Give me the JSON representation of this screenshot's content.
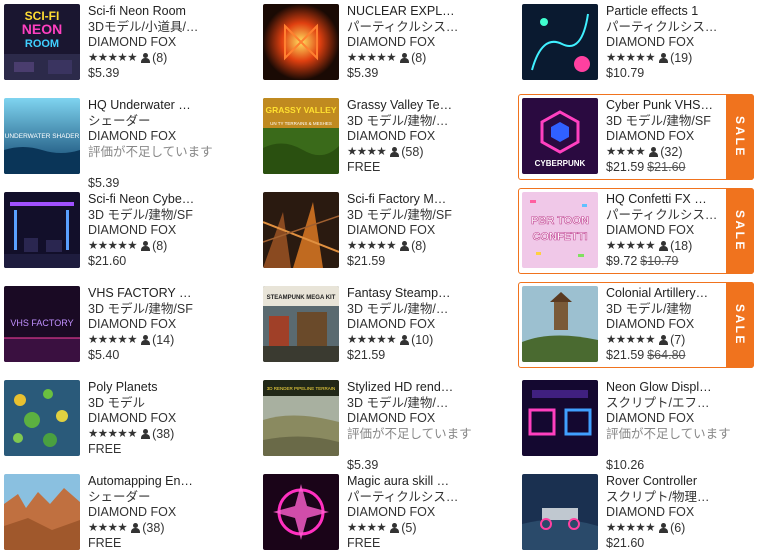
{
  "items": [
    {
      "title": "Sci-fi Neon Room",
      "category": "3Dモデル/小道具/…",
      "publisher": "DIAMOND FOX",
      "stars": "★★★★★",
      "ratings": "(8)",
      "price": "$5.39",
      "thumb": "neon-room"
    },
    {
      "title": "NUCLEAR EXPL…",
      "category": "パーティクルシス…",
      "publisher": "DIAMOND FOX",
      "stars": "★★★★★",
      "ratings": "(8)",
      "price": "$5.39",
      "thumb": "nuclear"
    },
    {
      "title": "Particle effects 1",
      "category": "パーティクルシス…",
      "publisher": "DIAMOND FOX",
      "stars": "★★★★★",
      "ratings": "(19)",
      "price": "$10.79",
      "thumb": "particle"
    },
    {
      "title": "HQ Underwater …",
      "category": "シェーダー",
      "publisher": "DIAMOND FOX",
      "no_rating": "評価が不足しています",
      "price": "$5.39",
      "thumb": "underwater"
    },
    {
      "title": "Grassy Valley Te…",
      "category": "3D モデル/建物/…",
      "publisher": "DIAMOND FOX",
      "stars": "★★★★",
      "ratings": "(58)",
      "price": "FREE",
      "thumb": "grassy"
    },
    {
      "title": "Cyber Punk VHS…",
      "category": "3D モデル/建物/SF",
      "publisher": "DIAMOND FOX",
      "stars": "★★★★",
      "ratings": "(32)",
      "price": "$21.59",
      "old_price": "$21.60",
      "sale": "SALE",
      "thumb": "cyberpunk"
    },
    {
      "title": "Sci-fi Neon Cybe…",
      "category": "3D モデル/建物/SF",
      "publisher": "DIAMOND FOX",
      "stars": "★★★★★",
      "ratings": "(8)",
      "price": "$21.60",
      "thumb": "neon-cyber"
    },
    {
      "title": "Sci-fi Factory M…",
      "category": "3D モデル/建物/SF",
      "publisher": "DIAMOND FOX",
      "stars": "★★★★★",
      "ratings": "(8)",
      "price": "$21.59",
      "thumb": "factory"
    },
    {
      "title": "HQ Confetti FX …",
      "category": "パーティクルシス…",
      "publisher": "DIAMOND FOX",
      "stars": "★★★★★",
      "ratings": "(18)",
      "price": "$9.72",
      "old_price": "$10.79",
      "sale": "SALE",
      "thumb": "confetti"
    },
    {
      "title": "VHS FACTORY …",
      "category": "3D モデル/建物/SF",
      "publisher": "DIAMOND FOX",
      "stars": "★★★★★",
      "ratings": "(14)",
      "price": "$5.40",
      "thumb": "vhs"
    },
    {
      "title": "Fantasy Steamp…",
      "category": "3D モデル/建物/…",
      "publisher": "DIAMOND FOX",
      "stars": "★★★★★",
      "ratings": "(10)",
      "price": "$21.59",
      "thumb": "steampunk"
    },
    {
      "title": "Colonial Artillery…",
      "category": "3D モデル/建物",
      "publisher": "DIAMOND FOX",
      "stars": "★★★★★",
      "ratings": "(7)",
      "price": "$21.59",
      "old_price": "$64.80",
      "sale": "SALE",
      "thumb": "colonial"
    },
    {
      "title": "Poly Planets",
      "category": "3D モデル",
      "publisher": "DIAMOND FOX",
      "stars": "★★★★★",
      "ratings": "(38)",
      "price": "FREE",
      "thumb": "planets"
    },
    {
      "title": "Stylized HD rend…",
      "category": "3D モデル/建物/…",
      "publisher": "DIAMOND FOX",
      "no_rating": "評価が不足しています",
      "price": "$5.39",
      "thumb": "stylized"
    },
    {
      "title": "Neon Glow Displ…",
      "category": "スクリプト/エフ…",
      "publisher": "DIAMOND FOX",
      "no_rating": "評価が不足しています",
      "price": "$10.26",
      "thumb": "neon-glow"
    },
    {
      "title": "Automapping En…",
      "category": "シェーダー",
      "publisher": "DIAMOND FOX",
      "stars": "★★★★",
      "ratings": "(38)",
      "price": "FREE",
      "thumb": "automapping"
    },
    {
      "title": "Magic aura skill …",
      "category": "パーティクルシス…",
      "publisher": "DIAMOND FOX",
      "stars": "★★★★",
      "ratings": "(5)",
      "price": "FREE",
      "thumb": "magic"
    },
    {
      "title": "Rover Controller",
      "category": "スクリプト/物理…",
      "publisher": "DIAMOND FOX",
      "stars": "★★★★★",
      "ratings": "(6)",
      "price": "$21.60",
      "thumb": "rover"
    }
  ],
  "thumb_text": {
    "neon_room": [
      "SCI-FI",
      "NEON",
      "ROOM"
    ],
    "underwater": "UNDERWATER SHADER",
    "grassy": "GRASSY VALLEY",
    "grassy_sub": "UN TY TERRAINS & MESHES",
    "cyberpunk": "CYBERPUNK",
    "confetti": [
      "PBR TOON",
      "CONFETTI"
    ],
    "vhs": "VHS FACTORY",
    "steampunk": "STEAMPUNK MEGA KIT",
    "stylized": "3D RENDER PIPELINE TERRAIN"
  },
  "colors": {
    "sale_orange": "#f0731e",
    "text": "#333333",
    "muted": "#888888"
  }
}
